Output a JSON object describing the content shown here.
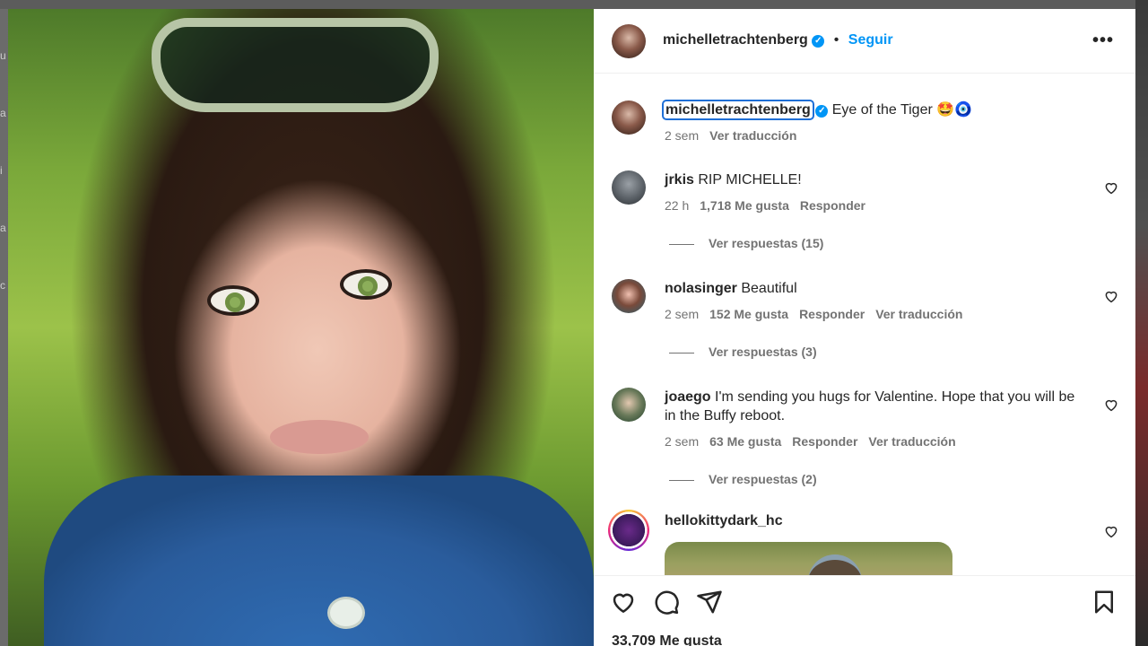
{
  "background": {
    "side_text": "u a i a c"
  },
  "post": {
    "author": "michelletrachtenberg",
    "verified": true,
    "follow_label": "Seguir",
    "dot": "•",
    "more_label": "•••",
    "caption": {
      "username": "michelletrachtenberg",
      "text": "Eye of the Tiger 🤩🧿",
      "time": "2 sem",
      "translate_label": "Ver traducción"
    },
    "comments": [
      {
        "username": "jrkis",
        "text": "RIP MICHELLE!",
        "time": "22 h",
        "likes": "1,718 Me gusta",
        "reply_label": "Responder",
        "replies_label": "Ver respuestas (15)"
      },
      {
        "username": "nolasinger",
        "text": "Beautiful",
        "time": "2 sem",
        "likes": "152 Me gusta",
        "reply_label": "Responder",
        "translate_label": "Ver traducción",
        "replies_label": "Ver respuestas (3)"
      },
      {
        "username": "joaego",
        "text": "I'm sending you hugs for Valentine. Hope that you will be in the Buffy reboot.",
        "time": "2 sem",
        "likes": "63 Me gusta",
        "reply_label": "Responder",
        "translate_label": "Ver traducción",
        "replies_label": "Ver respuestas (2)"
      },
      {
        "username": "hellokittydark_hc",
        "text": ""
      }
    ],
    "likes_total": "33,709 Me gusta"
  },
  "icons": {
    "verified": "✓",
    "like": "heart-icon",
    "comment": "comment-icon",
    "share": "send-icon",
    "save": "bookmark-icon"
  },
  "colors": {
    "accent": "#0095f6",
    "text": "#262626",
    "muted": "#737373"
  }
}
